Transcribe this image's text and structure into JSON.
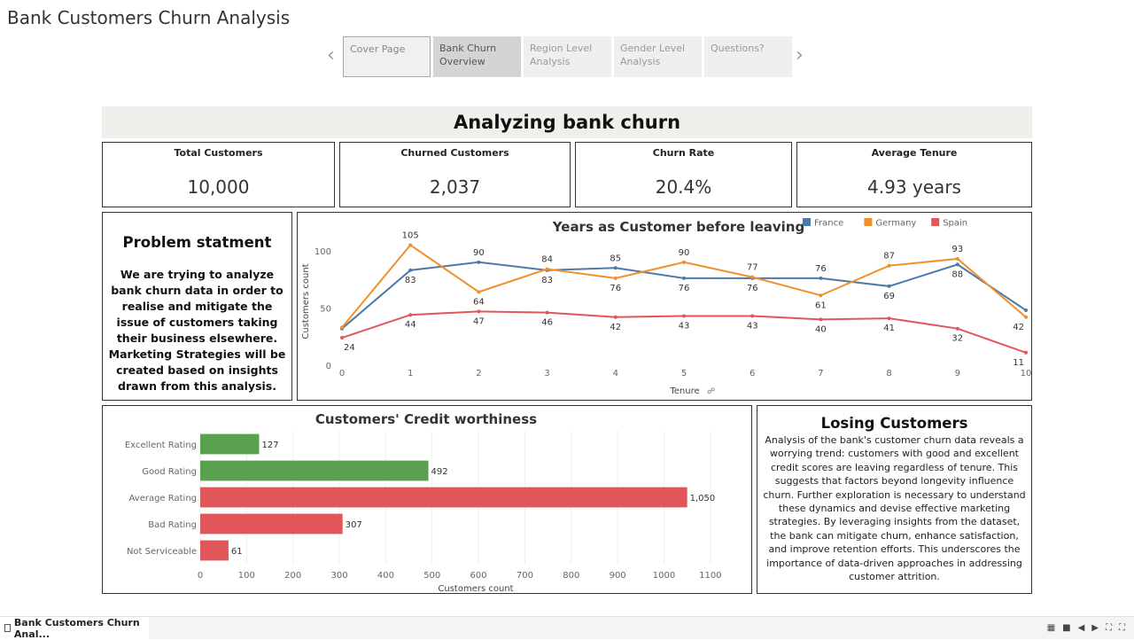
{
  "window": {
    "title": "Bank Customers Churn Analysis"
  },
  "nav": {
    "prev_icon": "chevron-left-icon",
    "next_icon": "chevron-right-icon",
    "tabs": [
      {
        "label": "Cover Page"
      },
      {
        "label": "Bank Churn Overview"
      },
      {
        "label": "Region Level Analysis"
      },
      {
        "label": "Gender Level Analysis"
      },
      {
        "label": "Questions?"
      }
    ],
    "active_index": 1
  },
  "dashboard": {
    "banner_title": "Analyzing bank churn",
    "kpis": [
      {
        "label": "Total Customers",
        "value": "10,000"
      },
      {
        "label": "Churned Customers",
        "value": "2,037"
      },
      {
        "label": "Churn Rate",
        "value": "20.4%"
      },
      {
        "label": "Average Tenure",
        "value": "4.93 years"
      }
    ],
    "problem": {
      "title": "Problem statment",
      "text": "We are trying to analyze bank churn data in order to realise and mitigate the issue of customers taking their business elsewhere. Marketing Strategies will be created based on insights drawn from this analysis."
    },
    "losing": {
      "title": "Losing Customers",
      "text": "Analysis of the bank's customer churn data reveals a worrying trend: customers with good and excellent credit scores are leaving regardless of tenure. This suggests that factors beyond longevity influence churn. Further exploration is necessary to understand these dynamics and devise effective marketing strategies. By leveraging insights from the dataset, the bank can mitigate churn, enhance satisfaction, and improve retention efforts. This underscores the importance of data-driven approaches in addressing customer attrition."
    }
  },
  "colors": {
    "france": "#4e79a7",
    "germany": "#f28e2b",
    "spain": "#e15759",
    "good": "#59a14f",
    "bad": "#e15759"
  },
  "chart_data": [
    {
      "type": "line",
      "title": "Years as Customer before leaving",
      "xlabel": "Tenure",
      "ylabel": "Customers count",
      "x": [
        0,
        1,
        2,
        3,
        4,
        5,
        6,
        7,
        8,
        9,
        10
      ],
      "xlim": [
        0,
        10
      ],
      "ylim": [
        0,
        110
      ],
      "yticks": [
        0,
        50,
        100
      ],
      "legend_position": "top-right",
      "series": [
        {
          "name": "France",
          "color": "#4e79a7",
          "values": [
            32,
            83,
            90,
            83,
            85,
            76,
            76,
            76,
            69,
            88,
            48
          ]
        },
        {
          "name": "Germany",
          "color": "#f28e2b",
          "values": [
            33,
            105,
            64,
            84,
            76,
            90,
            77,
            61,
            87,
            93,
            42
          ]
        },
        {
          "name": "Spain",
          "color": "#e15759",
          "values": [
            24,
            44,
            47,
            46,
            42,
            43,
            43,
            40,
            41,
            32,
            11
          ]
        }
      ],
      "point_labels": [
        {
          "x": 0,
          "value": "24"
        },
        {
          "x": 1,
          "value": "105"
        },
        {
          "x": 1,
          "value": "83"
        },
        {
          "x": 1,
          "value": "44"
        },
        {
          "x": 2,
          "value": "90"
        },
        {
          "x": 2,
          "value": "64"
        },
        {
          "x": 2,
          "value": "47"
        },
        {
          "x": 3,
          "value": "84"
        },
        {
          "x": 3,
          "value": "83"
        },
        {
          "x": 3,
          "value": "46"
        },
        {
          "x": 4,
          "value": "85"
        },
        {
          "x": 4,
          "value": "76"
        },
        {
          "x": 4,
          "value": "42"
        },
        {
          "x": 5,
          "value": "90"
        },
        {
          "x": 5,
          "value": "76"
        },
        {
          "x": 5,
          "value": "43"
        },
        {
          "x": 6,
          "value": "77"
        },
        {
          "x": 6,
          "value": "76"
        },
        {
          "x": 6,
          "value": "43"
        },
        {
          "x": 7,
          "value": "76"
        },
        {
          "x": 7,
          "value": "61"
        },
        {
          "x": 7,
          "value": "40"
        },
        {
          "x": 8,
          "value": "87"
        },
        {
          "x": 8,
          "value": "69"
        },
        {
          "x": 8,
          "value": "41"
        },
        {
          "x": 9,
          "value": "93"
        },
        {
          "x": 9,
          "value": "88"
        },
        {
          "x": 9,
          "value": "32"
        },
        {
          "x": 10,
          "value": "42"
        },
        {
          "x": 10,
          "value": "11"
        }
      ],
      "grid": false
    },
    {
      "type": "bar",
      "orientation": "horizontal",
      "title": "Customers' Credit worthiness",
      "xlabel": "Customers count",
      "categories": [
        "Excellent Rating",
        "Good Rating",
        "Average Rating",
        "Bad Rating",
        "Not Serviceable"
      ],
      "values": [
        127,
        492,
        1050,
        307,
        61
      ],
      "value_labels": [
        "127",
        "492",
        "1,050",
        "307",
        "61"
      ],
      "colors": [
        "#59a14f",
        "#59a14f",
        "#e15759",
        "#e15759",
        "#e15759"
      ],
      "xlim": [
        0,
        1150
      ],
      "xticks": [
        0,
        100,
        200,
        300,
        400,
        500,
        600,
        700,
        800,
        900,
        1000,
        1100
      ],
      "grid": true
    }
  ],
  "status_bar": {
    "sheet_tab": "Bank Customers Churn Anal..."
  }
}
